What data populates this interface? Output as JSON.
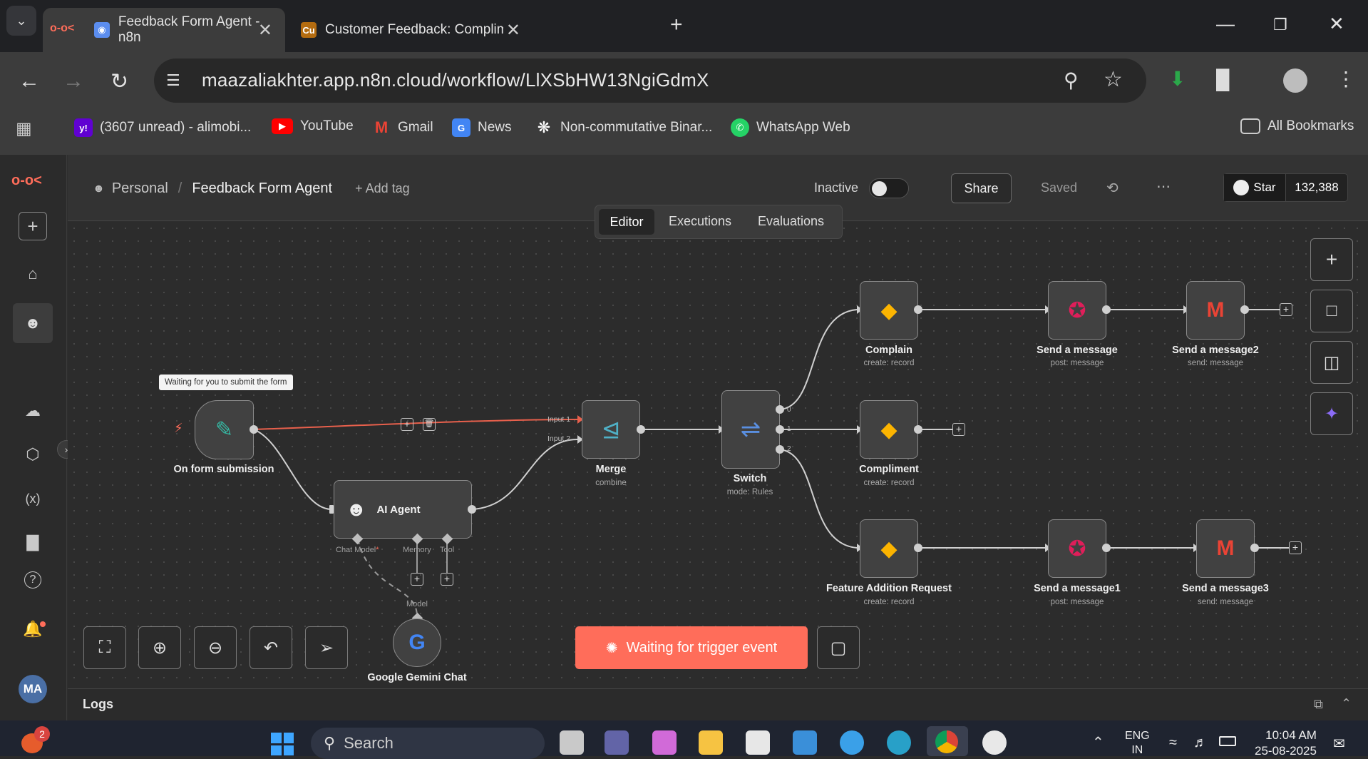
{
  "browser": {
    "tabs": [
      {
        "title": "Feedback Form Agent - n8n",
        "active": true
      },
      {
        "title": "Customer Feedback: Compliment - Ai",
        "favicon_text": "Cu",
        "active": false
      }
    ],
    "url": "maazaliakhter.app.n8n.cloud/workflow/LlXSbHW13NgiGdmX",
    "bookmarks": [
      {
        "label": "(3607 unread) - alimobi...",
        "icon": "yahoo-mail-icon",
        "icon_text": "y!"
      },
      {
        "label": "YouTube",
        "icon": "youtube-icon"
      },
      {
        "label": "Gmail",
        "icon": "gmail-icon"
      },
      {
        "label": "News",
        "icon": "google-news-icon",
        "icon_text": "G"
      },
      {
        "label": "Non-commutative Binar...",
        "icon": "openai-icon"
      },
      {
        "label": "WhatsApp Web",
        "icon": "whatsapp-icon"
      }
    ],
    "all_bookmarks": "All Bookmarks"
  },
  "header": {
    "breadcrumb_project": "Personal",
    "workflow_name": "Feedback Form Agent",
    "add_tag": "+ Add tag",
    "status_label": "Inactive",
    "share": "Share",
    "saved": "Saved",
    "github_star": "Star",
    "github_count": "132,388"
  },
  "tabs": {
    "editor": "Editor",
    "executions": "Executions",
    "evaluations": "Evaluations",
    "active": "Editor"
  },
  "nodes": {
    "trigger": {
      "label": "On form submission",
      "tooltip": "Waiting for you to submit the form"
    },
    "agent": {
      "label": "AI Agent",
      "port_chat": "Chat Model",
      "port_chat_required": "*",
      "port_memory": "Memory",
      "port_tool": "Tool"
    },
    "gemini": {
      "label": "Google Gemini Chat",
      "port": "Model"
    },
    "merge": {
      "label": "Merge",
      "sub": "combine",
      "input1": "Input 1",
      "input2": "Input 2"
    },
    "switch": {
      "label": "Switch",
      "sub": "mode: Rules",
      "out0": "0",
      "out1": "1",
      "out2": "2"
    },
    "complain": {
      "label": "Complain",
      "sub": "create: record"
    },
    "compliment": {
      "label": "Compliment",
      "sub": "create: record"
    },
    "feature": {
      "label": "Feature Addition Request",
      "sub": "create: record"
    },
    "slack1": {
      "label": "Send a message",
      "sub": "post: message"
    },
    "slack2": {
      "label": "Send a message1",
      "sub": "post: message"
    },
    "gmail1": {
      "label": "Send a message2",
      "sub": "send: message"
    },
    "gmail2": {
      "label": "Send a message3",
      "sub": "send: message"
    }
  },
  "waiting_banner": "Waiting for trigger event",
  "logs": "Logs",
  "sidebar": {
    "avatar_initials": "MA"
  },
  "taskbar": {
    "search_placeholder": "Search",
    "notification_count": "2",
    "lang_line1": "ENG",
    "lang_line2": "IN",
    "time": "10:04 AM",
    "date": "25-08-2025"
  },
  "colors": {
    "accent": "#ff6d5a",
    "node_bg": "#414141",
    "canvas_bg": "#2c2c2c"
  }
}
